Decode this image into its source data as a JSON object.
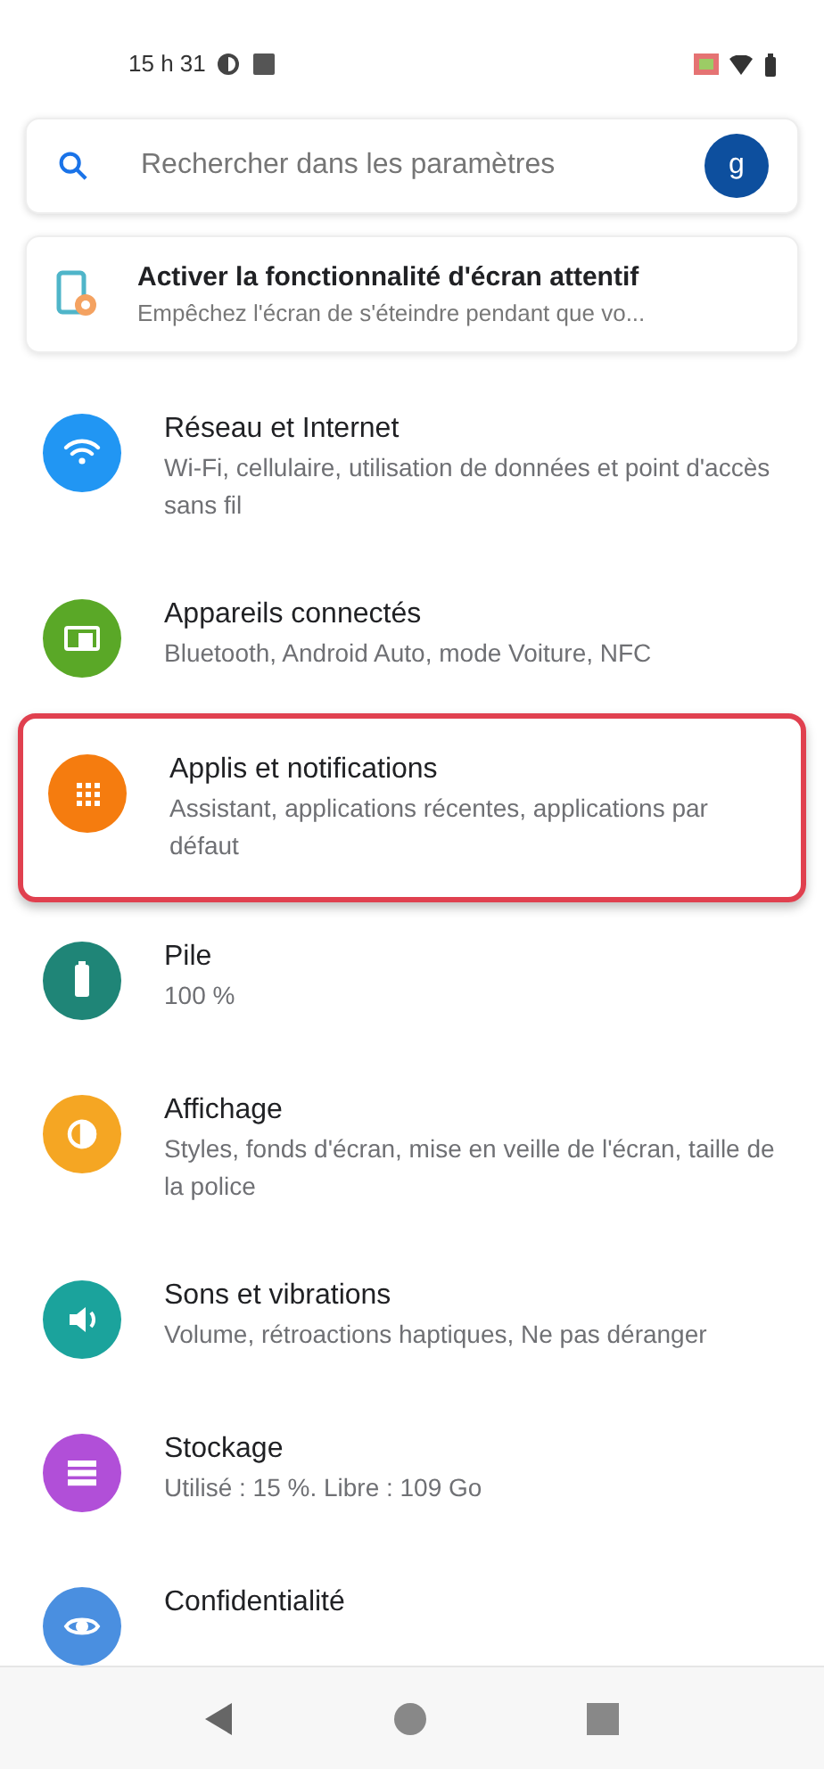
{
  "status_bar": {
    "time": "15 h 31"
  },
  "search": {
    "placeholder": "Rechercher dans les paramètres",
    "avatar": "g"
  },
  "suggestion": {
    "title": "Activer la fonctionnalité d'écran attentif",
    "subtitle": "Empêchez l'écran de s'éteindre pendant que vo..."
  },
  "items": [
    {
      "kind": "wifi",
      "color": "#2196f3",
      "title": "Réseau et Internet",
      "subtitle": "Wi-Fi, cellulaire, utilisation de données et point d'accès sans fil",
      "selected": false
    },
    {
      "kind": "devices",
      "color": "#5aa827",
      "title": "Appareils connectés",
      "subtitle": "Bluetooth, Android Auto, mode Voiture, NFC",
      "selected": false
    },
    {
      "kind": "apps",
      "color": "#f57c0f",
      "title": "Applis et notifications",
      "subtitle": "Assistant, applications récentes, applications par défaut",
      "selected": true
    },
    {
      "kind": "battery",
      "color": "#1f8577",
      "title": "Pile",
      "subtitle": "100 %",
      "selected": false
    },
    {
      "kind": "display",
      "color": "#f5a623",
      "title": "Affichage",
      "subtitle": "Styles, fonds d'écran, mise en veille de l'écran, taille de la police",
      "selected": false
    },
    {
      "kind": "sound",
      "color": "#1ba39c",
      "title": "Sons et vibrations",
      "subtitle": "Volume, rétroactions haptiques, Ne pas déranger",
      "selected": false
    },
    {
      "kind": "storage",
      "color": "#b14fd8",
      "title": "Stockage",
      "subtitle": "Utilisé : 15 %. Libre : 109 Go",
      "selected": false
    },
    {
      "kind": "privacy",
      "color": "#4a8fe0",
      "title": "Confidentialité",
      "selected": false
    }
  ]
}
